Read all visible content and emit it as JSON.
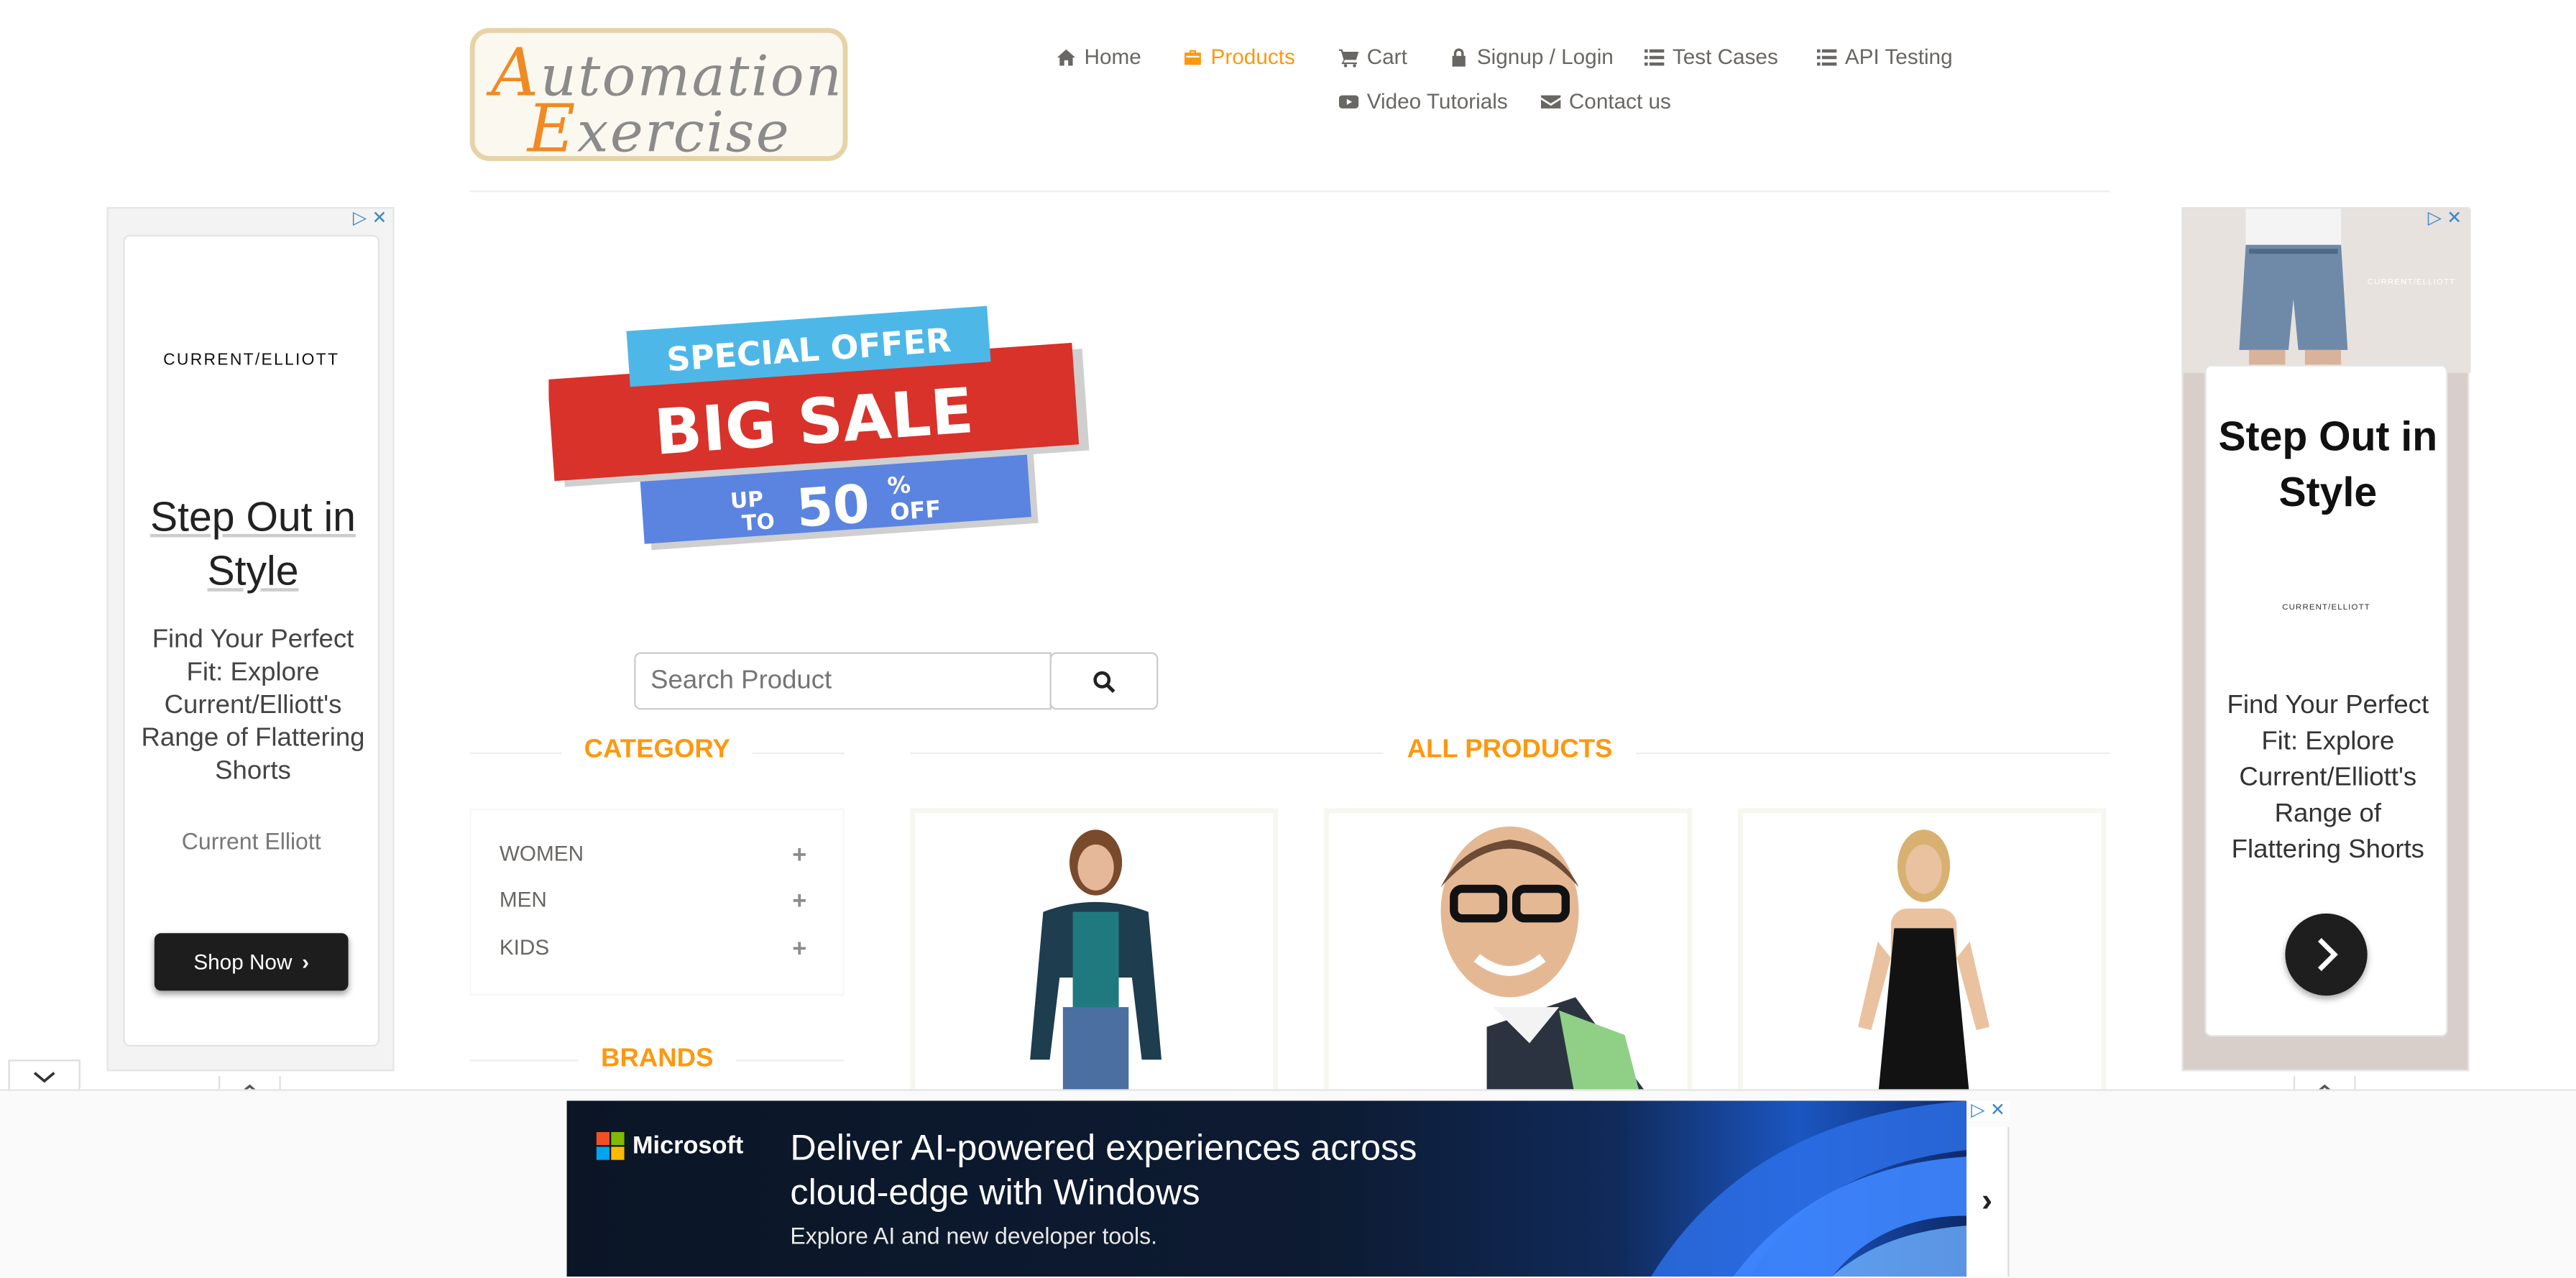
{
  "logo": {
    "line1_cap": "A",
    "line1_rest": "utomation",
    "line2_cap": "E",
    "line2_rest": "xercise"
  },
  "nav": {
    "home": "Home",
    "products": "Products",
    "cart": "Cart",
    "signup_login": "Signup / Login",
    "test_cases": "Test Cases",
    "api_testing": "API Testing",
    "video_tutorials": "Video Tutorials",
    "contact_us": "Contact us",
    "active_color": "#FE980F"
  },
  "left_ad": {
    "brand": "CURRENT/ELLIOTT",
    "headline": "Step Out in Style",
    "body": "Find Your Perfect Fit: Explore Current/Elliott's Range of Flattering Shorts",
    "advertiser": "Current Elliott",
    "cta": "Shop Now"
  },
  "right_ad": {
    "headline": "Step Out in Style",
    "brand": "CURRENT/ELLIOTT",
    "image_brand": "CURRENT/ELLIOTT",
    "body": "Find Your Perfect Fit: Explore Current/Elliott's Range of Flattering Shorts"
  },
  "banner": {
    "line1": "SPECIAL OFFER",
    "line2": "BIG SALE",
    "up": "UP",
    "to": "TO",
    "pct": "50",
    "sign": "%",
    "off": "OFF"
  },
  "search": {
    "placeholder": "Search Product"
  },
  "sidebar": {
    "category_title": "Category",
    "categories": [
      {
        "label": "WOMEN"
      },
      {
        "label": "MEN"
      },
      {
        "label": "KIDS"
      }
    ],
    "brands_title": "Brands"
  },
  "main": {
    "title": "All Products"
  },
  "bottom_ad": {
    "brand": "Microsoft",
    "headline_line1": "Deliver AI-powered experiences across",
    "headline_line2": "cloud-edge with Windows",
    "subline": "Explore AI and new developer tools.",
    "arrow": "›"
  }
}
